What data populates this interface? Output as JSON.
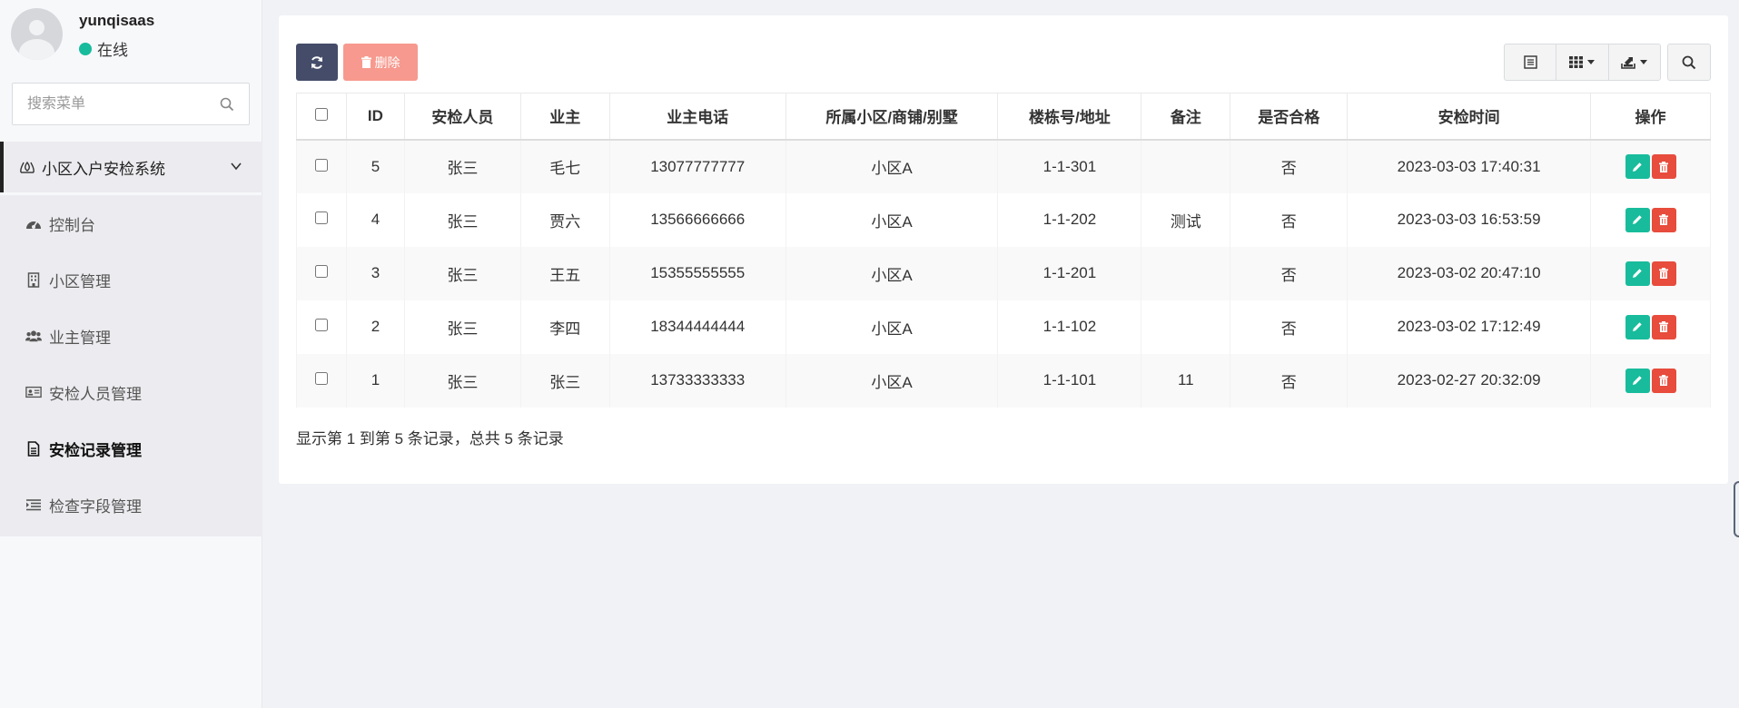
{
  "user": {
    "name": "yunqisaas",
    "status": "在线",
    "status_color": "#18bc9c"
  },
  "search": {
    "placeholder": "搜索菜单",
    "value": ""
  },
  "menu": {
    "group_label": "小区入户安检系统",
    "items": [
      {
        "label": "控制台",
        "icon": "dashboard-icon",
        "active": false
      },
      {
        "label": "小区管理",
        "icon": "building-icon",
        "active": false
      },
      {
        "label": "业主管理",
        "icon": "users-icon",
        "active": false
      },
      {
        "label": "安检人员管理",
        "icon": "id-card-icon",
        "active": false
      },
      {
        "label": "安检记录管理",
        "icon": "file-text-icon",
        "active": true
      },
      {
        "label": "检查字段管理",
        "icon": "list-indent-icon",
        "active": false
      }
    ]
  },
  "toolbar": {
    "delete_label": "删除",
    "refresh_color": "#444c69",
    "delete_color": "#f7998e"
  },
  "table": {
    "headers": [
      "ID",
      "安检人员",
      "业主",
      "业主电话",
      "所属小区/商铺/别墅",
      "楼栋号/地址",
      "备注",
      "是否合格",
      "安检时间",
      "操作"
    ],
    "rows": [
      {
        "id": "5",
        "inspector": "张三",
        "owner": "毛七",
        "phone": "13077777777",
        "community": "小区A",
        "address": "1-1-301",
        "remark": "",
        "qualified": "否",
        "time": "2023-03-03 17:40:31"
      },
      {
        "id": "4",
        "inspector": "张三",
        "owner": "贾六",
        "phone": "13566666666",
        "community": "小区A",
        "address": "1-1-202",
        "remark": "测试",
        "qualified": "否",
        "time": "2023-03-03 16:53:59"
      },
      {
        "id": "3",
        "inspector": "张三",
        "owner": "王五",
        "phone": "15355555555",
        "community": "小区A",
        "address": "1-1-201",
        "remark": "",
        "qualified": "否",
        "time": "2023-03-02 20:47:10"
      },
      {
        "id": "2",
        "inspector": "张三",
        "owner": "李四",
        "phone": "18344444444",
        "community": "小区A",
        "address": "1-1-102",
        "remark": "",
        "qualified": "否",
        "time": "2023-03-02 17:12:49"
      },
      {
        "id": "1",
        "inspector": "张三",
        "owner": "张三",
        "phone": "13733333333",
        "community": "小区A",
        "address": "1-1-101",
        "remark": "11",
        "qualified": "否",
        "time": "2023-02-27 20:32:09"
      }
    ]
  },
  "pagination": {
    "info": "显示第 1 到第 5 条记录，总共 5 条记录"
  }
}
